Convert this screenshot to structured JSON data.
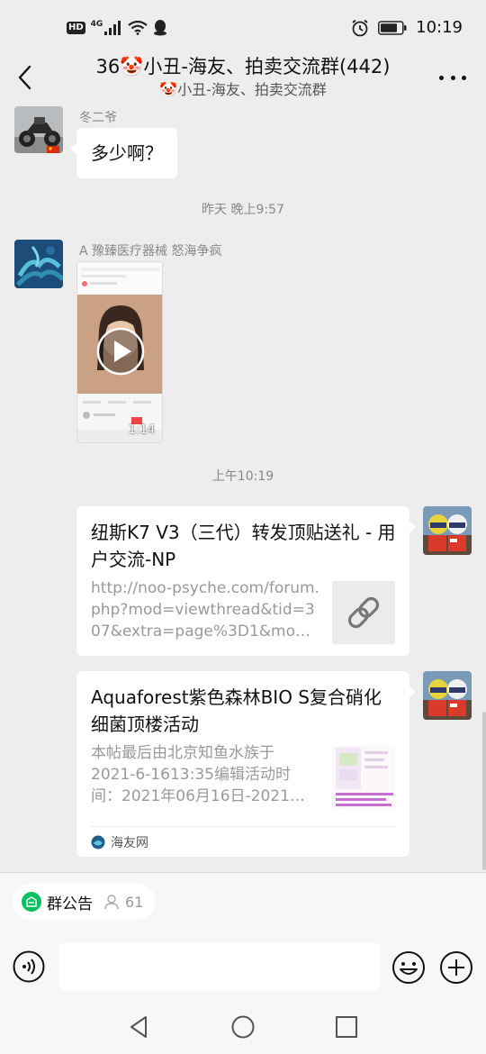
{
  "status_bar": {
    "hd": "HD",
    "network": "4G",
    "time": "10:19"
  },
  "header": {
    "title": "36🤡小丑-海友、拍卖交流群(442)",
    "subtitle": "🤡小丑-海友、拍卖交流群"
  },
  "messages": {
    "msg1": {
      "sender": "冬二爷",
      "text": "多少啊？"
    },
    "time1": "昨天 晚上9:57",
    "msg2": {
      "sender": "A   豫臻医疗器械 怒海争疯",
      "video_duration": "1:14"
    },
    "time2": "上午10:19",
    "card1": {
      "title": "纽斯K7 V3（三代）转发顶贴送礼 - 用户交流-NP",
      "desc": "http://noo-psyche.com/forum.php?mod=viewthread&tid=307&extra=page%3D1&mo…",
      "thumb_icon": "link-icon"
    },
    "card2": {
      "title": "Aquaforest紫色森林BIO S复合硝化细菌顶楼活动",
      "desc": "本帖最后由北京知鱼水族于 2021-6-1613:35编辑活动时间：2021年06月16日-2021…",
      "source": "海友网"
    }
  },
  "bottom": {
    "notice_label": "群公告",
    "member_count": "61",
    "input_value": ""
  },
  "colors": {
    "accent_green": "#07c160",
    "background": "#ededed"
  }
}
